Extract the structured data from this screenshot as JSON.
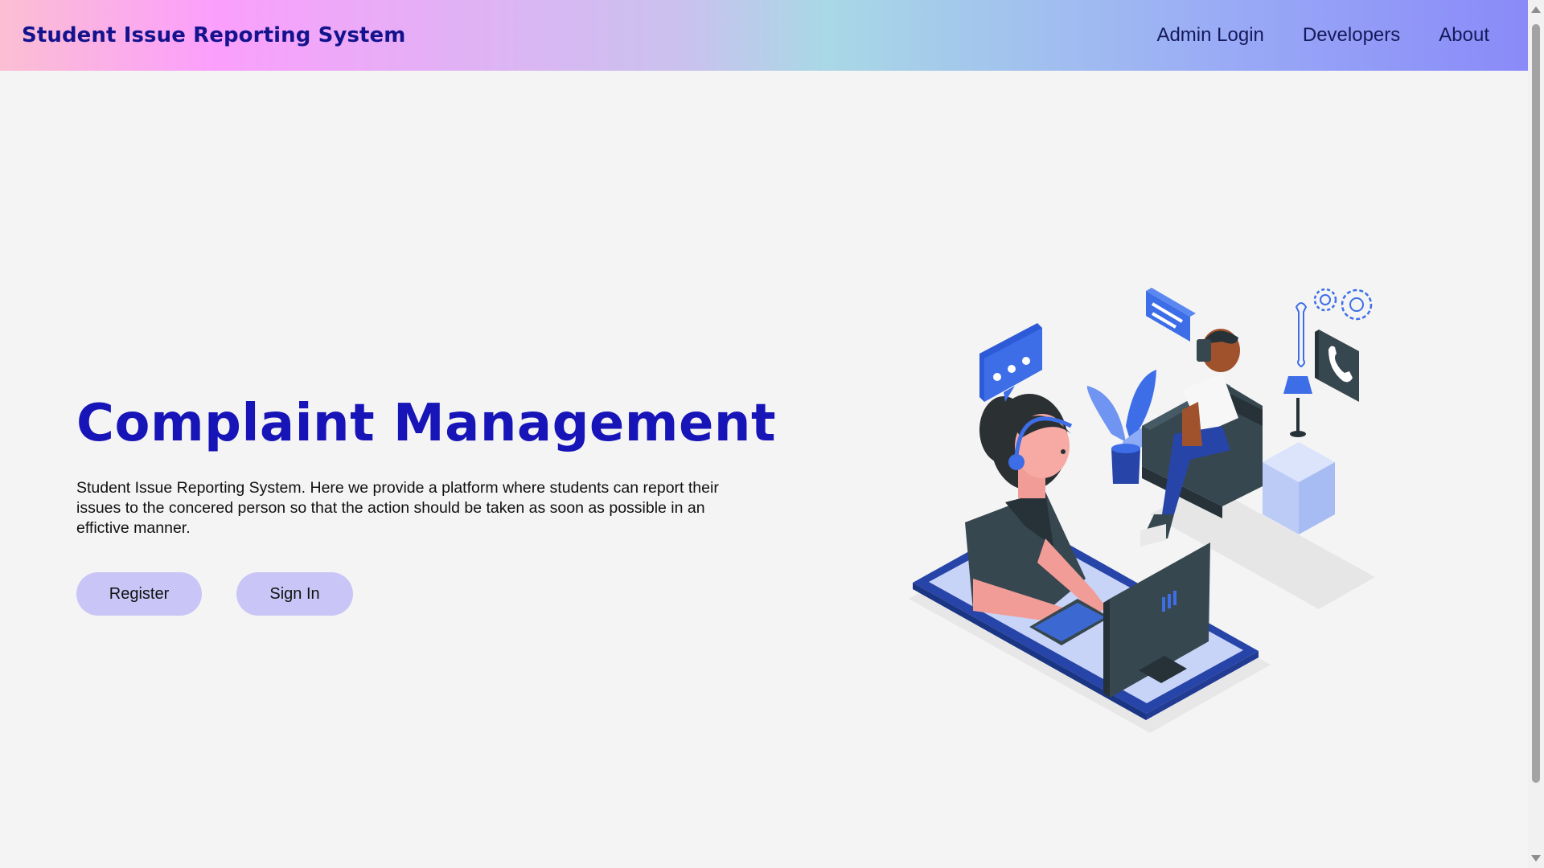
{
  "navbar": {
    "brand": "Student Issue Reporting System",
    "links": [
      "Admin Login",
      "Developers",
      "About"
    ]
  },
  "hero": {
    "title": "Complaint Management",
    "description": "Student Issue Reporting System. Here we provide a platform where students can report their issues to the concered person so that the action should be taken as soon as possible in an effictive manner.",
    "buttons": {
      "register": "Register",
      "signin": "Sign In"
    }
  },
  "colors": {
    "title": "#1714b8",
    "brand": "#13148d",
    "button_bg": "#c9c5f6",
    "page_bg": "#f4f4f4",
    "illustration_accent": "#3d6ee8",
    "illustration_dark": "#37474f"
  },
  "illustration": {
    "name": "customer-support-illustration",
    "icons": [
      "chat-bubble-icon",
      "message-icon",
      "gear-icon",
      "wrench-icon",
      "phone-icon"
    ]
  }
}
